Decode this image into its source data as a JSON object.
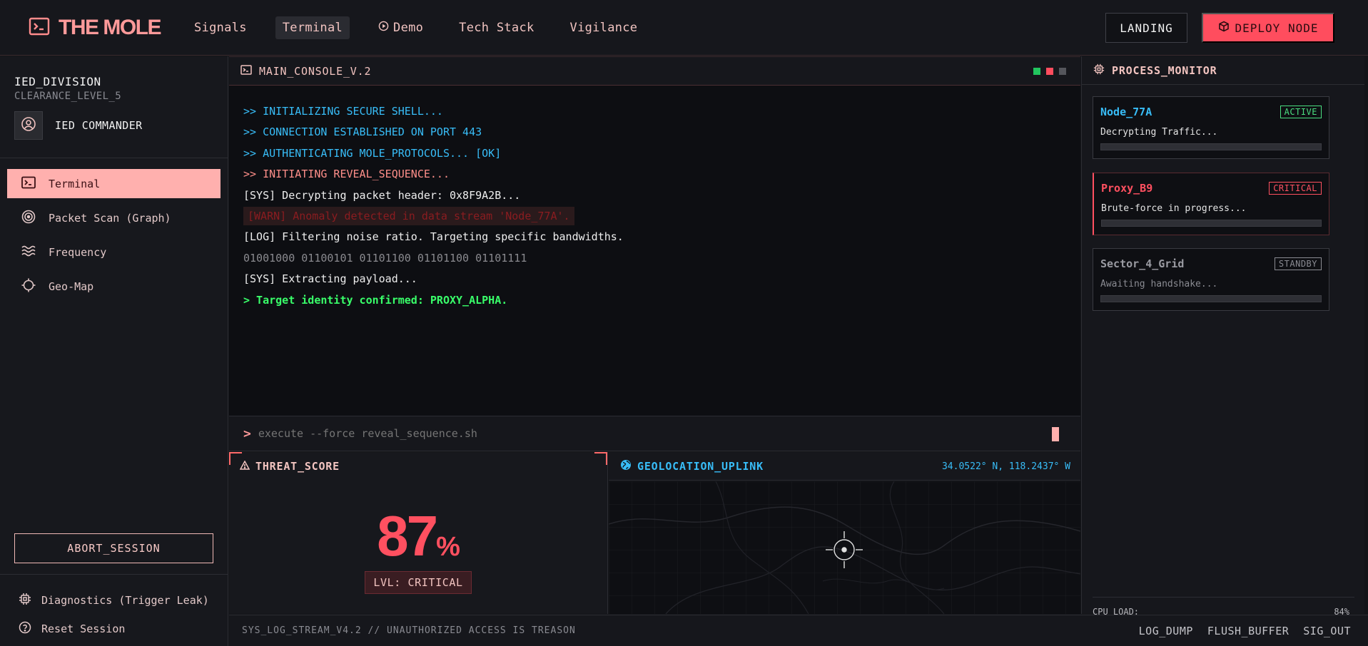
{
  "brand": {
    "name": "THE MOLE",
    "icon": "terminal-icon"
  },
  "nav": {
    "links": [
      {
        "label": "Signals"
      },
      {
        "label": "Terminal"
      },
      {
        "label": "Demo",
        "icon": "play-circle-icon"
      },
      {
        "label": "Tech Stack"
      },
      {
        "label": "Vigilance"
      }
    ],
    "active": "Terminal",
    "landing_label": "LANDING",
    "deploy_label": "DEPLOY NODE"
  },
  "sidebar": {
    "division": "IED_DIVISION",
    "clearance": "CLEARANCE_LEVEL_5",
    "commander": "IED COMMANDER",
    "items": [
      {
        "label": "Terminal",
        "icon": "terminal-icon"
      },
      {
        "label": "Packet Scan (Graph)",
        "icon": "radar-icon"
      },
      {
        "label": "Frequency",
        "icon": "waves-icon"
      },
      {
        "label": "Geo-Map",
        "icon": "crosshair-icon"
      }
    ],
    "abort_label": "ABORT_SESSION",
    "bottom_items": [
      {
        "label": "Diagnostics (Trigger Leak)",
        "icon": "chip-icon"
      },
      {
        "label": "Reset Session",
        "icon": "help-circle-icon"
      }
    ]
  },
  "console": {
    "title": "MAIN_CONSOLE_V.2",
    "lines": [
      {
        "text": ">> INITIALIZING SECURE SHELL...",
        "style": "cyan"
      },
      {
        "text": ">> CONNECTION ESTABLISHED ON PORT 443",
        "style": "cyan"
      },
      {
        "text": ">> AUTHENTICATING MOLE_PROTOCOLS... [OK]",
        "style": "cyan"
      },
      {
        "text": ">> INITIATING REVEAL_SEQUENCE...",
        "style": "salmon"
      },
      {
        "text": "[SYS] Decrypting packet header: 0x8F9A2B...",
        "style": "white"
      },
      {
        "text": "[WARN] Anomaly detected in data stream 'Node_77A'.",
        "style": "warn"
      },
      {
        "text": "[LOG] Filtering noise ratio. Targeting specific bandwidths.",
        "style": "white"
      },
      {
        "text": "01001000 01100101 01101100 01101100 01101111",
        "style": "gray"
      },
      {
        "text": "[SYS] Extracting payload...",
        "style": "white"
      },
      {
        "text": "> Target identity confirmed: PROXY_ALPHA.",
        "style": "green"
      }
    ],
    "prompt": ">",
    "command_placeholder": "execute --force reveal_sequence.sh",
    "dot_colors": [
      "#22c55e",
      "#ff4d5e",
      "#55565c"
    ]
  },
  "threat": {
    "title": "THREAT_SCORE",
    "score": "87",
    "unit": "%",
    "level": "LVL: CRITICAL"
  },
  "geo": {
    "title": "GEOLOCATION_UPLINK",
    "coords": "34.0522° N, 118.2437° W"
  },
  "process_monitor": {
    "title": "PROCESS_MONITOR",
    "processes": [
      {
        "name": "Node_77A",
        "status": "ACTIVE",
        "desc": "Decrypting Traffic...",
        "color": "#38bdf8",
        "badge_color": "#4ade80",
        "progress": 0.0
      },
      {
        "name": "Proxy_B9",
        "status": "CRITICAL",
        "desc": "Brute-force in progress...",
        "color": "#ff5060",
        "badge_color": "#ff5060",
        "progress": 0.0
      },
      {
        "name": "Sector_4_Grid",
        "status": "STANDBY",
        "desc": "Awaiting handshake...",
        "color": "#9a9ba2",
        "badge_color": "#8a8b92",
        "progress": 0.0
      }
    ],
    "cpu_label": "CPU_LOAD:",
    "cpu_value": "84%"
  },
  "footer": {
    "text": "SYS_LOG_STREAM_V4.2 // UNAUTHORIZED ACCESS IS TREASON",
    "links": [
      "LOG_DUMP",
      "FLUSH_BUFFER",
      "SIG_OUT"
    ]
  }
}
